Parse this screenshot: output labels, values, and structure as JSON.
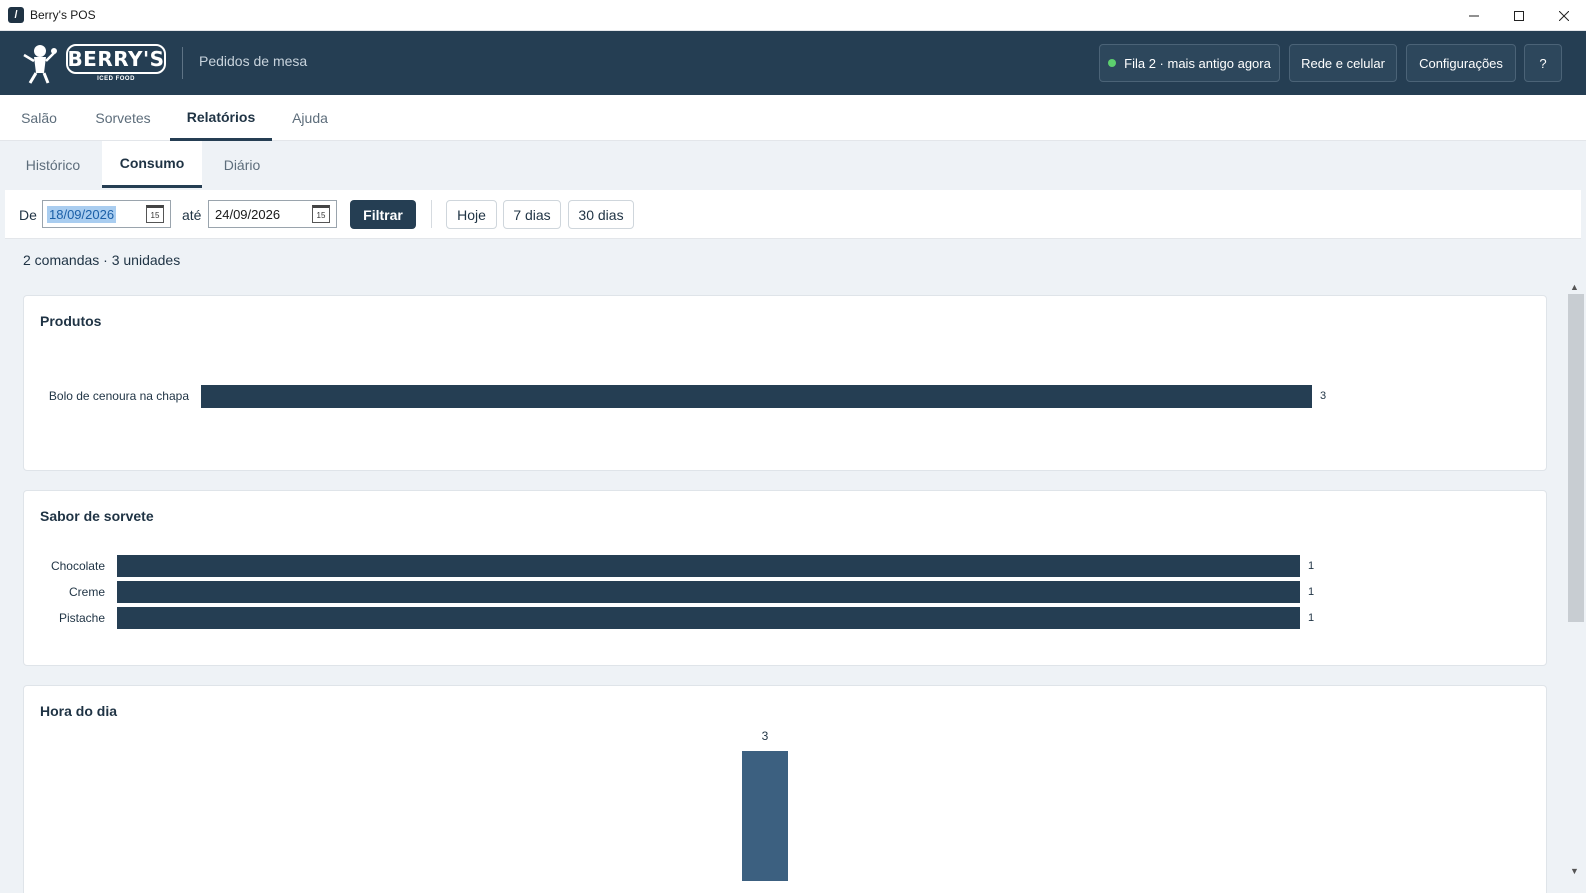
{
  "window": {
    "title": "Berry's POS",
    "controls": [
      "minimize-icon",
      "maximize-icon",
      "close-icon"
    ]
  },
  "header": {
    "logo_text": "BERRY'S",
    "logo_subtext": "ICED FOOD",
    "subtitle": "Pedidos de mesa",
    "status_label": "Fila 2 · mais antigo agora",
    "status_color": "#5ccf6e",
    "network_label": "Rede e celular",
    "settings_label": "Configurações",
    "help_label": "?"
  },
  "main_tabs": [
    {
      "label": "Salão",
      "active": false
    },
    {
      "label": "Sorvetes",
      "active": false
    },
    {
      "label": "Relatórios",
      "active": true
    },
    {
      "label": "Ajuda",
      "active": false
    }
  ],
  "sub_tabs": [
    {
      "label": "Histórico",
      "active": false
    },
    {
      "label": "Consumo",
      "active": true
    },
    {
      "label": "Diário",
      "active": false
    }
  ],
  "filter": {
    "from_label": "De",
    "from_value": "18/09/2026",
    "to_label": "até",
    "to_value": "24/09/2026",
    "calendar_icon_text": "15",
    "filter_button": "Filtrar",
    "quick_today": "Hoje",
    "quick_7": "7 dias",
    "quick_30": "30 dias"
  },
  "summary": "2 comandas · 3 unidades",
  "accent_color": "#253e53",
  "chart_data": [
    {
      "type": "bar",
      "orientation": "horizontal",
      "title": "Produtos",
      "categories": [
        "Bolo de cenoura na chapa"
      ],
      "values": [
        3
      ]
    },
    {
      "type": "bar",
      "orientation": "horizontal",
      "title": "Sabor de sorvete",
      "categories": [
        "Chocolate",
        "Creme",
        "Pistache"
      ],
      "values": [
        1,
        1,
        1
      ]
    },
    {
      "type": "bar",
      "orientation": "vertical",
      "title": "Hora do dia",
      "values": [
        3
      ]
    }
  ]
}
